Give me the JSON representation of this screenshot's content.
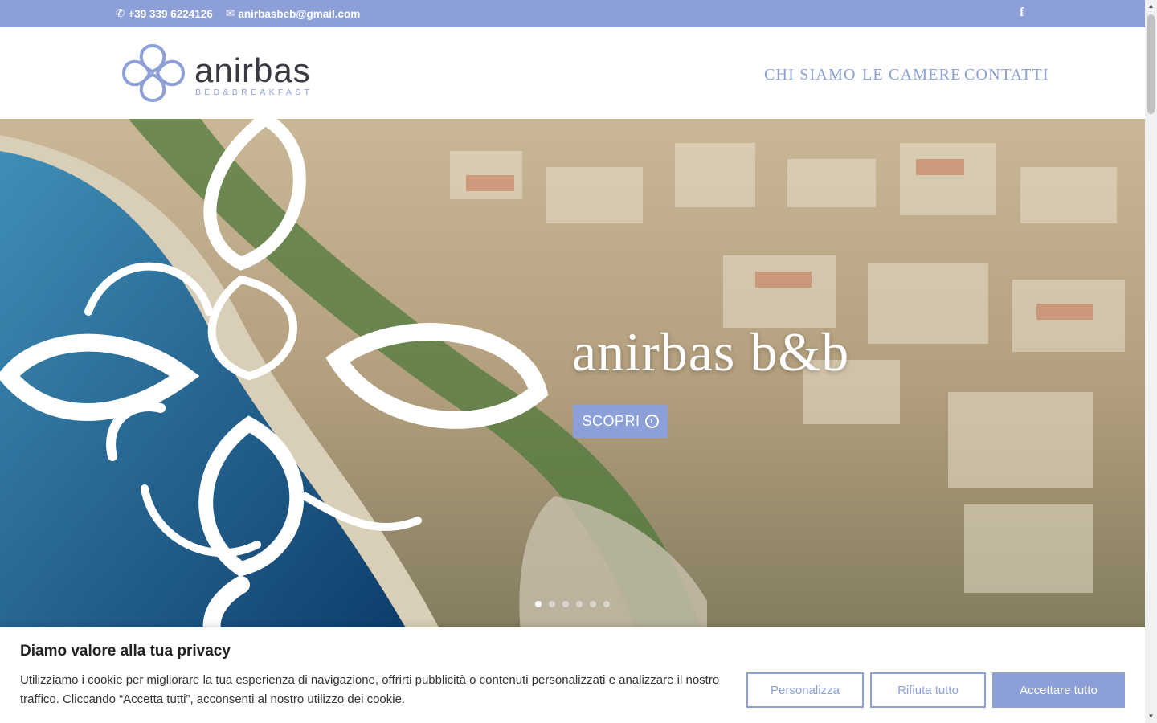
{
  "topbar": {
    "phone": "+39 339 6224126",
    "email": "anirbasbeb@gmail.com",
    "social_icon": "facebook-icon",
    "social_glyph": "f"
  },
  "brand": {
    "name": "anirbas",
    "tagline": "BED&BREAKFAST",
    "accent": "#8c9fd6"
  },
  "nav": {
    "items": [
      {
        "label": "CHI SIAMO"
      },
      {
        "label": "LE CAMERE"
      },
      {
        "label": "CONTATTI"
      }
    ]
  },
  "hero": {
    "title": "anirbas b&b",
    "cta_label": "SCOPRI",
    "cta_icon": "chevron-circle-right-icon",
    "slide_count": 6,
    "active_slide": 1
  },
  "cookie_banner": {
    "title": "Diamo valore alla tua privacy",
    "text": "Utilizziamo i cookie per migliorare la tua esperienza di navigazione, offrirti pubblicità o contenuti personalizzati e analizzare il nostro traffico. Cliccando “Accetta tutti”, acconsenti al nostro utilizzo dei cookie.",
    "customize_label": "Personalizza",
    "reject_label": "Rifiuta tutto",
    "accept_label": "Accettare tutto"
  }
}
